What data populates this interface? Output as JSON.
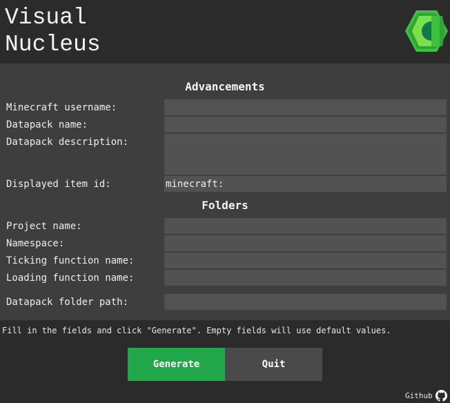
{
  "app": {
    "title_line1": "Visual",
    "title_line2": "Nucleus",
    "logo_icon": "nucleus-hexagon-logo",
    "logo_colors": [
      "#3fbf3f",
      "#6fe04a",
      "#0f7a4a"
    ]
  },
  "advancements": {
    "title": "Advancements",
    "username_label": "Minecraft username:",
    "username_value": "",
    "datapack_name_label": "Datapack name:",
    "datapack_name_value": "",
    "description_label": "Datapack description:",
    "description_value": "",
    "item_id_label": "Displayed item id:",
    "item_id_value": "minecraft:"
  },
  "folders": {
    "title": "Folders",
    "project_name_label": "Project name:",
    "project_name_value": "",
    "namespace_label": "Namespace:",
    "namespace_value": "",
    "ticking_label": "Ticking function name:",
    "ticking_value": "",
    "loading_label": "Loading function name:",
    "loading_value": "",
    "folder_path_label": "Datapack folder path:",
    "folder_path_value": ""
  },
  "hint": "Fill in the fields and click \"Generate\". Empty fields will use default values.",
  "actions": {
    "generate_label": "Generate",
    "quit_label": "Quit",
    "generate_color": "#22a84a"
  },
  "footer": {
    "github_label": "Github",
    "github_icon": "github-icon"
  }
}
